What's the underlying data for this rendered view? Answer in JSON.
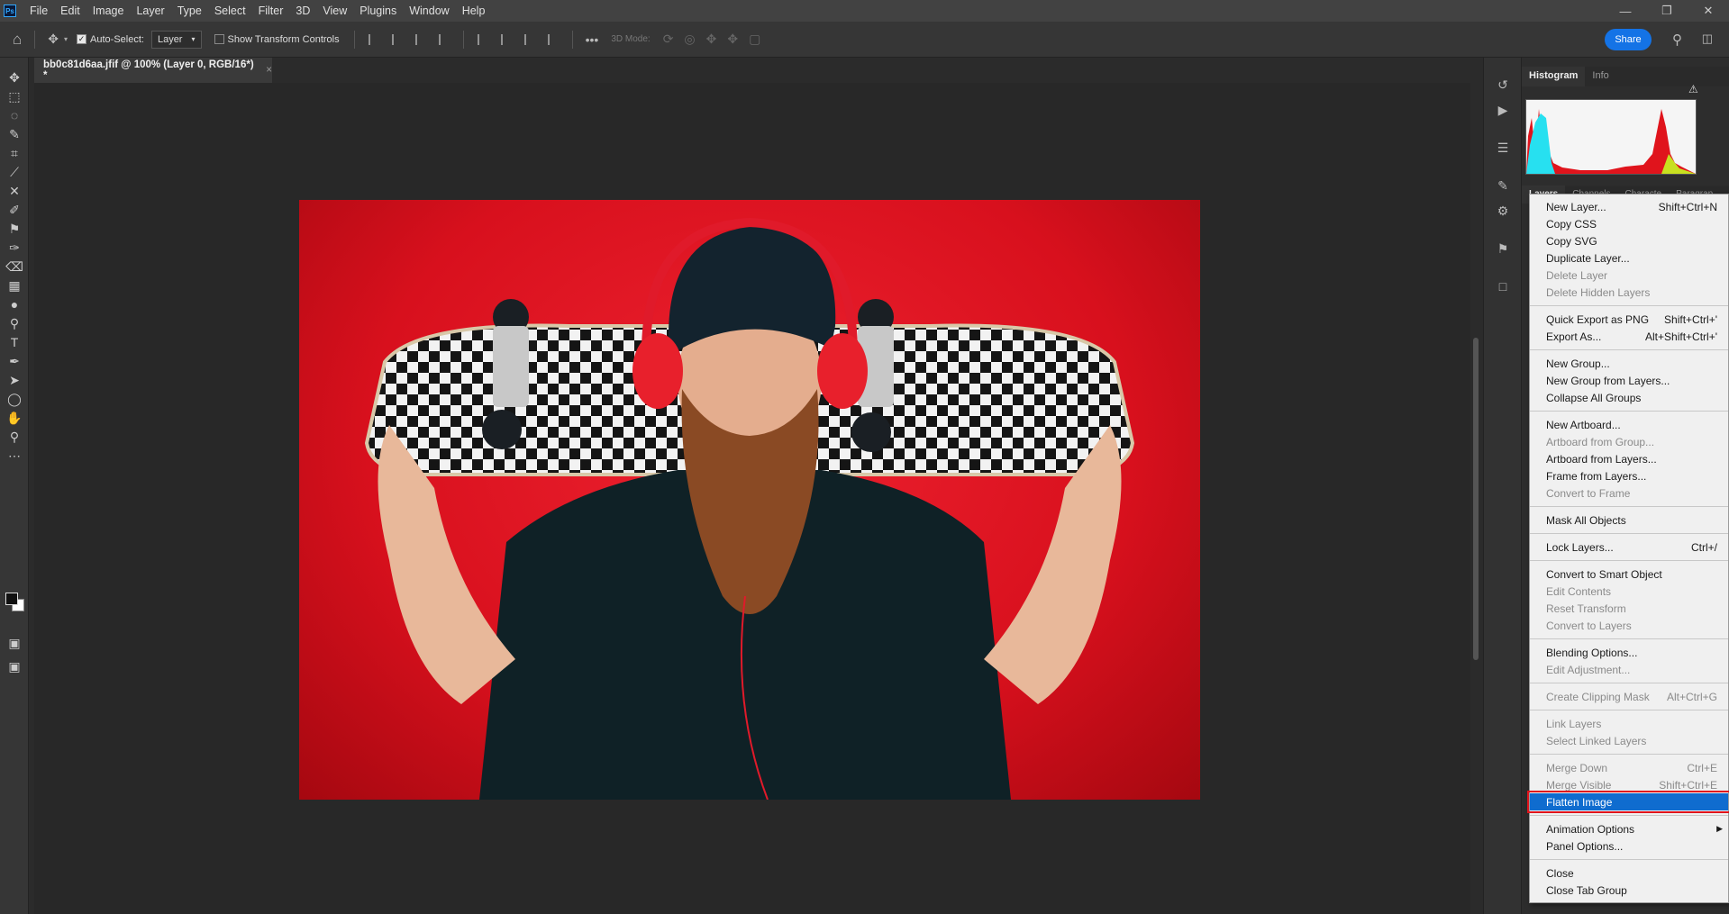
{
  "menubar": {
    "logo": "Ps",
    "items": [
      "File",
      "Edit",
      "Image",
      "Layer",
      "Type",
      "Select",
      "Filter",
      "3D",
      "View",
      "Plugins",
      "Window",
      "Help"
    ]
  },
  "options": {
    "auto_select_label": "Auto-Select:",
    "auto_select_value": "Layer",
    "transform_controls_label": "Show Transform Controls",
    "mode_3d_label": "3D Mode:",
    "share_label": "Share"
  },
  "document": {
    "tab_title": "bb0c81d6aa.jfif @ 100% (Layer 0, RGB/16*) *",
    "close_glyph": "×"
  },
  "panels": {
    "top_tabs": [
      "Histogram",
      "Info"
    ],
    "bottom_tabs": [
      "Layers",
      "Channels",
      "Characte",
      "Paragrap"
    ]
  },
  "context_menu": {
    "groups": [
      [
        {
          "label": "New Layer...",
          "shortcut": "Shift+Ctrl+N",
          "enabled": true
        },
        {
          "label": "Copy CSS",
          "shortcut": "",
          "enabled": true
        },
        {
          "label": "Copy SVG",
          "shortcut": "",
          "enabled": true
        },
        {
          "label": "Duplicate Layer...",
          "shortcut": "",
          "enabled": true
        },
        {
          "label": "Delete Layer",
          "shortcut": "",
          "enabled": false
        },
        {
          "label": "Delete Hidden Layers",
          "shortcut": "",
          "enabled": false
        }
      ],
      [
        {
          "label": "Quick Export as PNG",
          "shortcut": "Shift+Ctrl+'",
          "enabled": true
        },
        {
          "label": "Export As...",
          "shortcut": "Alt+Shift+Ctrl+'",
          "enabled": true
        }
      ],
      [
        {
          "label": "New Group...",
          "shortcut": "",
          "enabled": true
        },
        {
          "label": "New Group from Layers...",
          "shortcut": "",
          "enabled": true
        },
        {
          "label": "Collapse All Groups",
          "shortcut": "",
          "enabled": true
        }
      ],
      [
        {
          "label": "New Artboard...",
          "shortcut": "",
          "enabled": true
        },
        {
          "label": "Artboard from Group...",
          "shortcut": "",
          "enabled": false
        },
        {
          "label": "Artboard from Layers...",
          "shortcut": "",
          "enabled": true
        },
        {
          "label": "Frame from Layers...",
          "shortcut": "",
          "enabled": true
        },
        {
          "label": "Convert to Frame",
          "shortcut": "",
          "enabled": false
        }
      ],
      [
        {
          "label": "Mask All Objects",
          "shortcut": "",
          "enabled": true
        }
      ],
      [
        {
          "label": "Lock Layers...",
          "shortcut": "Ctrl+/",
          "enabled": true
        }
      ],
      [
        {
          "label": "Convert to Smart Object",
          "shortcut": "",
          "enabled": true
        },
        {
          "label": "Edit Contents",
          "shortcut": "",
          "enabled": false
        },
        {
          "label": "Reset Transform",
          "shortcut": "",
          "enabled": false
        },
        {
          "label": "Convert to Layers",
          "shortcut": "",
          "enabled": false
        }
      ],
      [
        {
          "label": "Blending Options...",
          "shortcut": "",
          "enabled": true
        },
        {
          "label": "Edit Adjustment...",
          "shortcut": "",
          "enabled": false
        }
      ],
      [
        {
          "label": "Create Clipping Mask",
          "shortcut": "Alt+Ctrl+G",
          "enabled": false
        }
      ],
      [
        {
          "label": "Link Layers",
          "shortcut": "",
          "enabled": false
        },
        {
          "label": "Select Linked Layers",
          "shortcut": "",
          "enabled": false
        }
      ],
      [
        {
          "label": "Merge Down",
          "shortcut": "Ctrl+E",
          "enabled": false
        },
        {
          "label": "Merge Visible",
          "shortcut": "Shift+Ctrl+E",
          "enabled": false
        },
        {
          "label": "Flatten Image",
          "shortcut": "",
          "enabled": true,
          "highlight": true
        }
      ],
      [
        {
          "label": "Animation Options",
          "shortcut": "",
          "enabled": true,
          "submenu": true
        },
        {
          "label": "Panel Options...",
          "shortcut": "",
          "enabled": true
        }
      ],
      [
        {
          "label": "Close",
          "shortcut": "",
          "enabled": true
        },
        {
          "label": "Close Tab Group",
          "shortcut": "",
          "enabled": true
        }
      ]
    ]
  },
  "colors": {
    "accent": "#1473e6",
    "highlight": "#0f6ccf",
    "highlight_outline": "#e0141c",
    "photo_bg": "#d8101d"
  }
}
